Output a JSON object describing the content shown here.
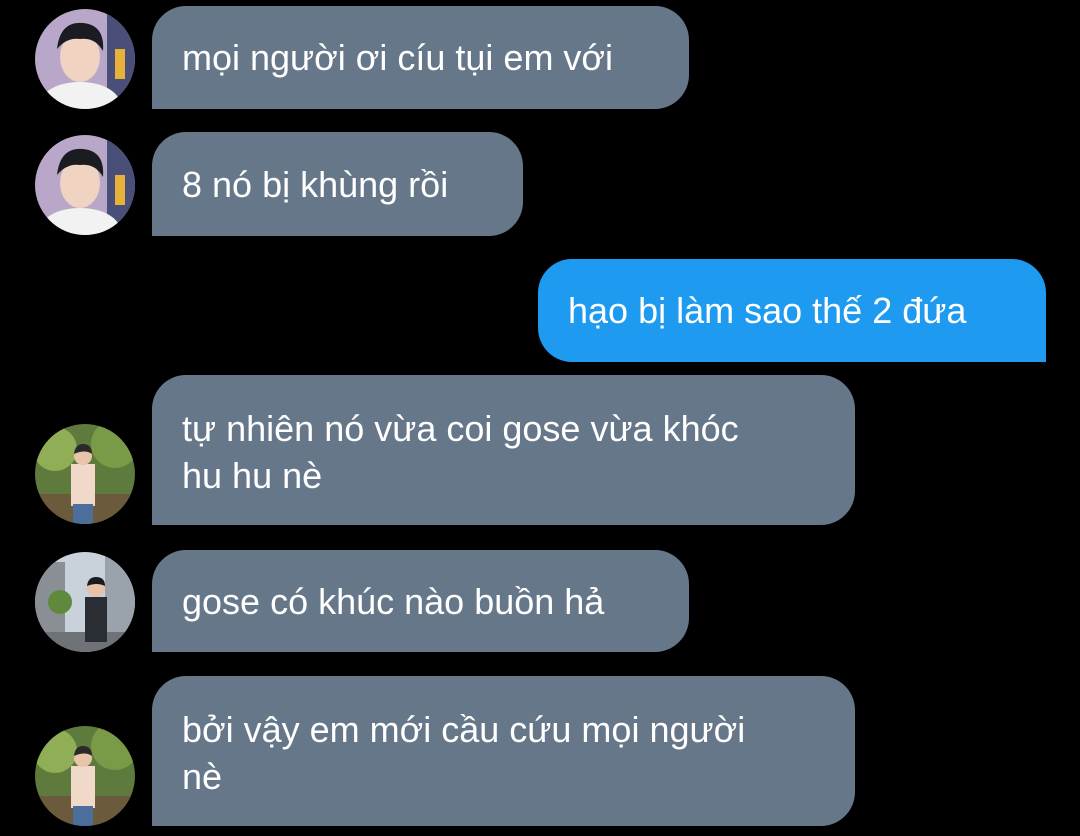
{
  "conversation": {
    "messages": [
      {
        "sender": "other",
        "avatar": "avatar-1",
        "text": "mọi người ơi cíu tụi em với"
      },
      {
        "sender": "other",
        "avatar": "avatar-1",
        "text": "8 nó bị khùng rồi"
      },
      {
        "sender": "me",
        "text": "hạo bị làm sao thế 2 đứa"
      },
      {
        "sender": "other",
        "avatar": "avatar-2",
        "text": "tự nhiên nó vừa coi gose vừa khóc",
        "text_line2": "hu hu nè"
      },
      {
        "sender": "other",
        "avatar": "avatar-3",
        "text": "gose có khúc nào buồn hả"
      },
      {
        "sender": "other",
        "avatar": "avatar-2",
        "text": "bởi vậy em mới cầu cứu mọi người",
        "text_line2": "nè"
      }
    ]
  },
  "colors": {
    "background": "#000000",
    "incoming_bubble": "#66778a",
    "outgoing_bubble": "#1e9bf0",
    "text": "#ffffff"
  }
}
